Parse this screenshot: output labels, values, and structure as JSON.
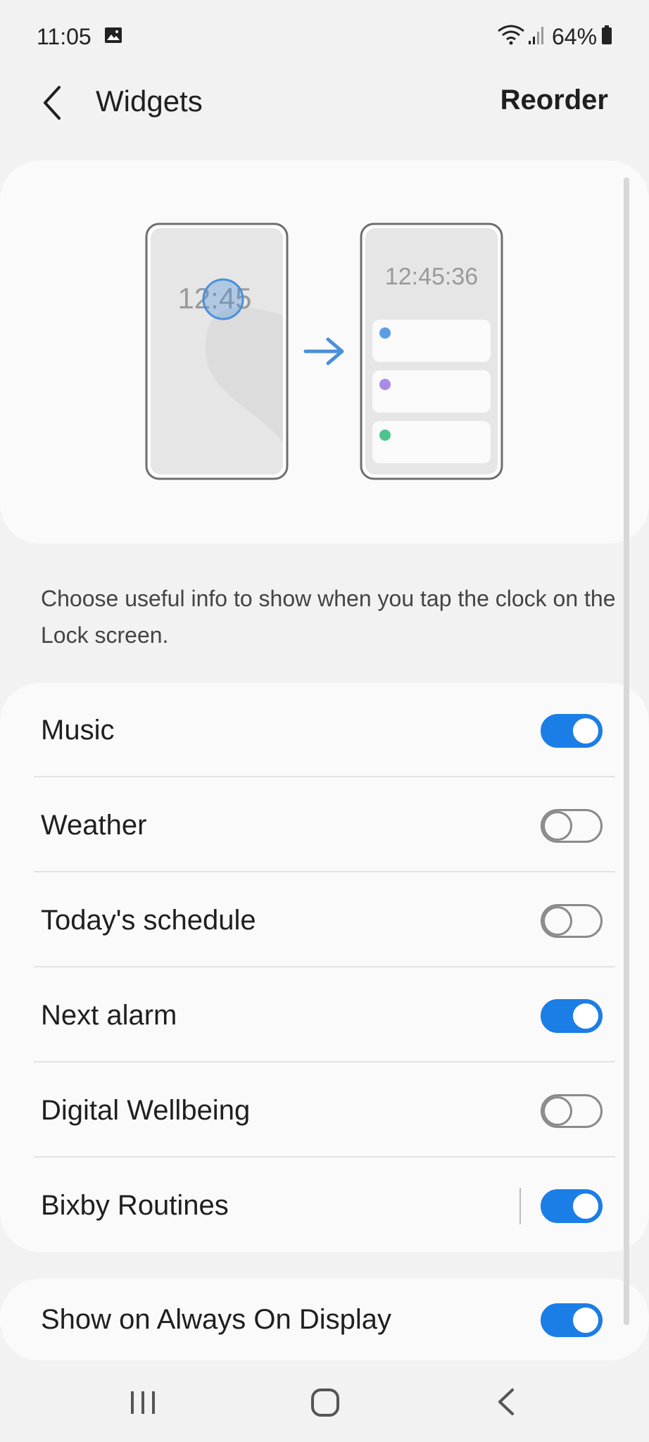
{
  "status_bar": {
    "time": "11:05",
    "battery": "64%",
    "icons": [
      "gallery-icon",
      "wifi-icon",
      "signal-icon",
      "battery-icon"
    ]
  },
  "app_bar": {
    "title": "Widgets",
    "action": "Reorder"
  },
  "illustration": {
    "clock_left": "12:45",
    "clock_right": "12:45:36",
    "dot_colors": [
      "#5b9ee6",
      "#a78be6",
      "#4fc38e"
    ],
    "accent": "#4a90d9"
  },
  "description": "Choose useful info to show when you tap the clock on the Lock screen.",
  "widgets": [
    {
      "label": "Music",
      "on": true
    },
    {
      "label": "Weather",
      "on": false
    },
    {
      "label": "Today's schedule",
      "on": false
    },
    {
      "label": "Next alarm",
      "on": true
    },
    {
      "label": "Digital Wellbeing",
      "on": false
    },
    {
      "label": "Bixby Routines",
      "on": true
    }
  ],
  "aod": {
    "label": "Show on Always On Display",
    "on": true
  },
  "colors": {
    "toggle_on": "#1b7ee6",
    "background": "#f2f2f2",
    "card": "#fafafa"
  }
}
